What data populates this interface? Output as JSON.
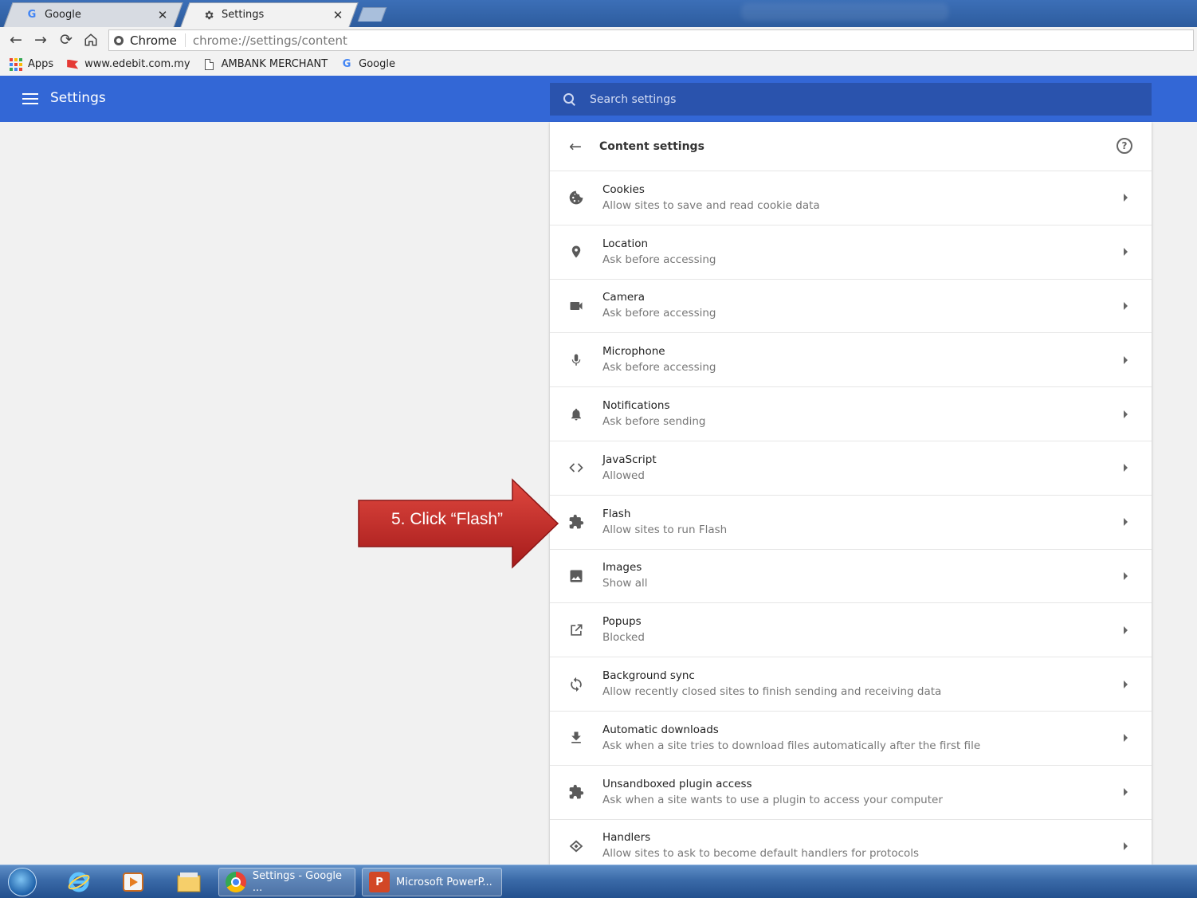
{
  "browser": {
    "tabs": [
      {
        "title": "Google",
        "icon": "google-g-icon",
        "close": "✕"
      },
      {
        "title": "Settings",
        "icon": "gear-icon",
        "close": "✕"
      }
    ],
    "omnibox": {
      "chip": "Chrome",
      "url": "chrome://settings/content"
    },
    "bookmarks": [
      {
        "label": "Apps",
        "icon": "apps-grid-icon"
      },
      {
        "label": "www.edebit.com.my",
        "icon": "red-flag-icon"
      },
      {
        "label": "AMBANK MERCHANT",
        "icon": "document-icon"
      },
      {
        "label": "Google",
        "icon": "google-g-icon"
      }
    ]
  },
  "header": {
    "title": "Settings",
    "search_placeholder": "Search settings",
    "color": "#3367d6",
    "search_bg": "#2a53ad"
  },
  "content": {
    "title": "Content settings",
    "rows": [
      {
        "label": "Cookies",
        "sub": "Allow sites to save and read cookie data",
        "icon": "cookie-icon"
      },
      {
        "label": "Location",
        "sub": "Ask before accessing",
        "icon": "location-pin-icon"
      },
      {
        "label": "Camera",
        "sub": "Ask before accessing",
        "icon": "camera-icon"
      },
      {
        "label": "Microphone",
        "sub": "Ask before accessing",
        "icon": "microphone-icon"
      },
      {
        "label": "Notifications",
        "sub": "Ask before sending",
        "icon": "bell-icon"
      },
      {
        "label": "JavaScript",
        "sub": "Allowed",
        "icon": "code-icon"
      },
      {
        "label": "Flash",
        "sub": "Allow sites to run Flash",
        "icon": "puzzle-icon"
      },
      {
        "label": "Images",
        "sub": "Show all",
        "icon": "image-icon"
      },
      {
        "label": "Popups",
        "sub": "Blocked",
        "icon": "popup-icon"
      },
      {
        "label": "Background sync",
        "sub": "Allow recently closed sites to finish sending and receiving data",
        "icon": "sync-icon"
      },
      {
        "label": "Automatic downloads",
        "sub": "Ask when a site tries to download files automatically after the first file",
        "icon": "download-icon"
      },
      {
        "label": "Unsandboxed plugin access",
        "sub": "Ask when a site wants to use a plugin to access your computer",
        "icon": "puzzle-icon"
      },
      {
        "label": "Handlers",
        "sub": "Allow sites to ask to become default handlers for protocols",
        "icon": "handlers-icon"
      }
    ]
  },
  "callout": {
    "text": "5. Click “Flash”",
    "color": "#c62828"
  },
  "taskbar": {
    "tasks": [
      {
        "label": "Settings - Google ...",
        "icon": "chrome-icon"
      },
      {
        "label": "Microsoft PowerP...",
        "icon": "powerpoint-icon"
      }
    ]
  }
}
